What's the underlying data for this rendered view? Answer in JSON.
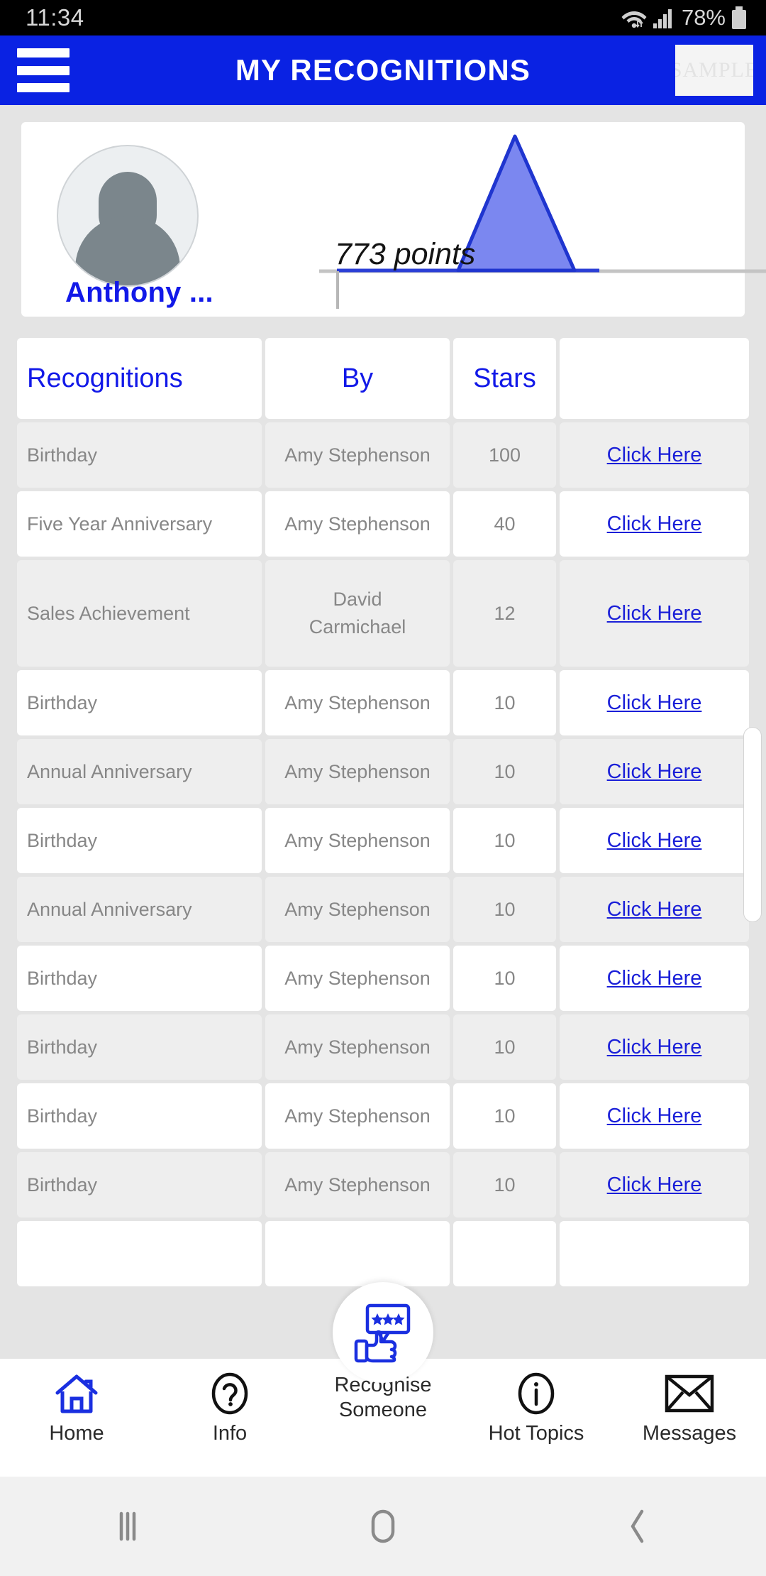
{
  "statusbar": {
    "time": "11:34",
    "battery_percent": "78%",
    "wifi_icon": "wifi-icon",
    "signal_icon": "cellular-signal-icon",
    "battery_icon": "battery-icon"
  },
  "appbar": {
    "menu_icon": "hamburger-menu-icon",
    "title": "MY RECOGNITIONS",
    "logo_text": "SAMPLE"
  },
  "profile": {
    "avatar_icon": "default-avatar-icon",
    "name": "Anthony ...",
    "points_label": "773 points",
    "points_value": 773,
    "accent_color": "#1219e8",
    "chart_fill": "#7b87f0",
    "chart_stroke": "#1f35cf"
  },
  "chart_data": {
    "type": "area",
    "title": "773 points",
    "categories": [
      "",
      "",
      "",
      "",
      ""
    ],
    "values": [
      0,
      0,
      0,
      773,
      0
    ],
    "series": [
      {
        "name": "Points",
        "values": [
          0,
          0,
          0,
          773,
          0
        ]
      }
    ],
    "xlabel": "",
    "ylabel": "",
    "ylim": [
      0,
      800
    ],
    "grid": false,
    "legend": "none",
    "annotations": [
      "773 points"
    ]
  },
  "table": {
    "columns": [
      "Recognitions",
      "By",
      "Stars",
      ""
    ],
    "link_label": "Click Here",
    "rows": [
      {
        "recognition": "Birthday",
        "by": "Amy Stephenson",
        "stars": "100"
      },
      {
        "recognition": "Five Year Anniversary",
        "by": "Amy Stephenson",
        "stars": "40"
      },
      {
        "recognition": "Sales Achievement",
        "by": "David Carmichael",
        "by_line1": "David",
        "by_line2": "Carmichael",
        "stars": "12"
      },
      {
        "recognition": "Birthday",
        "by": "Amy Stephenson",
        "stars": "10"
      },
      {
        "recognition": "Annual Anniversary",
        "by": "Amy Stephenson",
        "stars": "10"
      },
      {
        "recognition": "Birthday",
        "by": "Amy Stephenson",
        "stars": "10"
      },
      {
        "recognition": "Annual Anniversary",
        "by": "Amy Stephenson",
        "stars": "10"
      },
      {
        "recognition": "Birthday",
        "by": "Amy Stephenson",
        "stars": "10"
      },
      {
        "recognition": "Birthday",
        "by": "Amy Stephenson",
        "stars": "10"
      },
      {
        "recognition": "Birthday",
        "by": "Amy Stephenson",
        "stars": "10"
      },
      {
        "recognition": "Birthday",
        "by": "Amy Stephenson",
        "stars": "10"
      }
    ]
  },
  "bottomnav": {
    "items": [
      {
        "label": "Home",
        "icon": "home-icon"
      },
      {
        "label": "Info",
        "icon": "question-mark-icon"
      },
      {
        "label": "Recognise Someone",
        "label_line1": "Recognise",
        "label_line2": "Someone",
        "icon": "thumbs-up-stars-icon"
      },
      {
        "label": "Hot Topics",
        "icon": "info-circle-icon"
      },
      {
        "label": "Messages",
        "icon": "envelope-icon"
      }
    ]
  },
  "androidnav": {
    "recents_icon": "recents-icon",
    "home_icon": "home-square-icon",
    "back_icon": "back-chevron-icon"
  }
}
